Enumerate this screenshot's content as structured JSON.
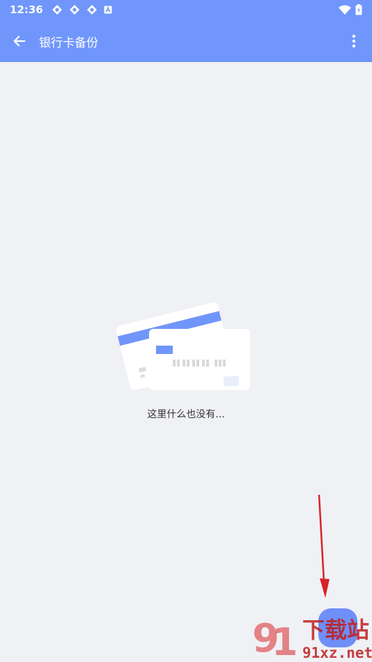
{
  "status_bar": {
    "time": "12:36"
  },
  "app_bar": {
    "title": "银行卡备份"
  },
  "empty_state": {
    "message": "这里什么也没有..."
  },
  "watermark": {
    "brand": "下载站",
    "domain": "91xz.net"
  },
  "colors": {
    "primary": "#7096fb",
    "background": "#f0f1f5",
    "fab": "#6f8ff9",
    "annotation": "#d8222a"
  },
  "icons": {
    "back": "arrow-back-icon",
    "more": "more-vert-icon",
    "wifi": "wifi-icon",
    "battery": "battery-icon"
  }
}
